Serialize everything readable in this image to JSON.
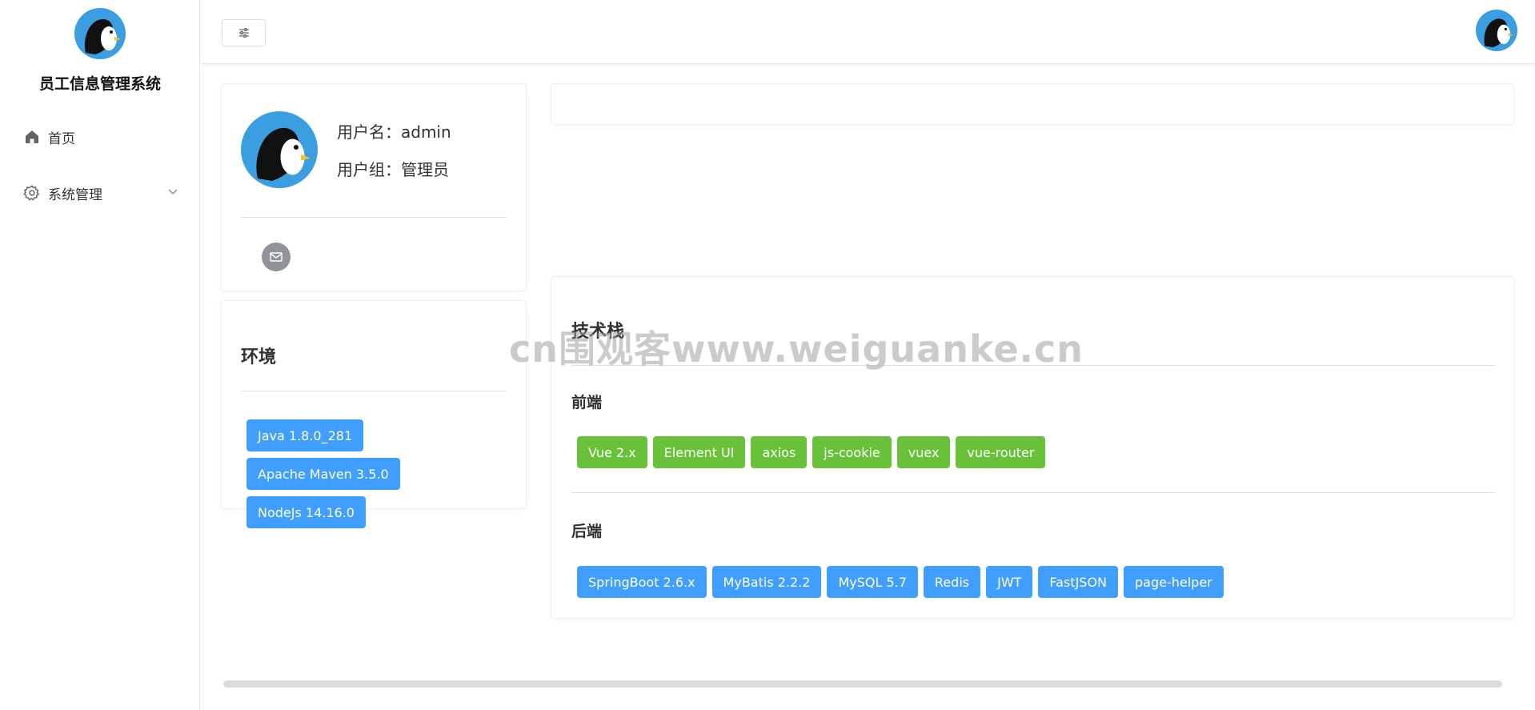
{
  "colors": {
    "primary": "#409eff",
    "success": "#67c23a",
    "info": "#909399",
    "avatar_bg": "#3b9ee0"
  },
  "sidebar": {
    "app_title": "员工信息管理系统",
    "logo_icon": "penguin-logo-icon",
    "items": [
      {
        "label": "首页",
        "icon": "home-icon"
      },
      {
        "label": "系统管理",
        "icon": "gear-icon",
        "chevron": "chevron-down-icon"
      }
    ]
  },
  "header": {
    "toggle_icon": "sliders-icon",
    "avatar_icon": "penguin-avatar-icon"
  },
  "user_card": {
    "username_label": "用户名：",
    "username": "admin",
    "group_label": "用户组：",
    "group": "管理员",
    "mail_icon": "mail-icon"
  },
  "env_card": {
    "title": "环境",
    "tags": [
      "Java 1.8.0_281",
      "Apache Maven 3.5.0",
      "NodeJs 14.16.0"
    ]
  },
  "tech_card": {
    "title": "技术栈",
    "frontend": {
      "title": "前端",
      "tags": [
        "Vue 2.x",
        "Element UI",
        "axios",
        "js-cookie",
        "vuex",
        "vue-router"
      ]
    },
    "backend": {
      "title": "后端",
      "tags": [
        "SpringBoot 2.6.x",
        "MyBatis 2.2.2",
        "MySQL 5.7",
        "Redis",
        "JWT",
        "FastJSON",
        "page-helper"
      ]
    }
  },
  "watermark": "cn围观客www.weiguanke.cn"
}
